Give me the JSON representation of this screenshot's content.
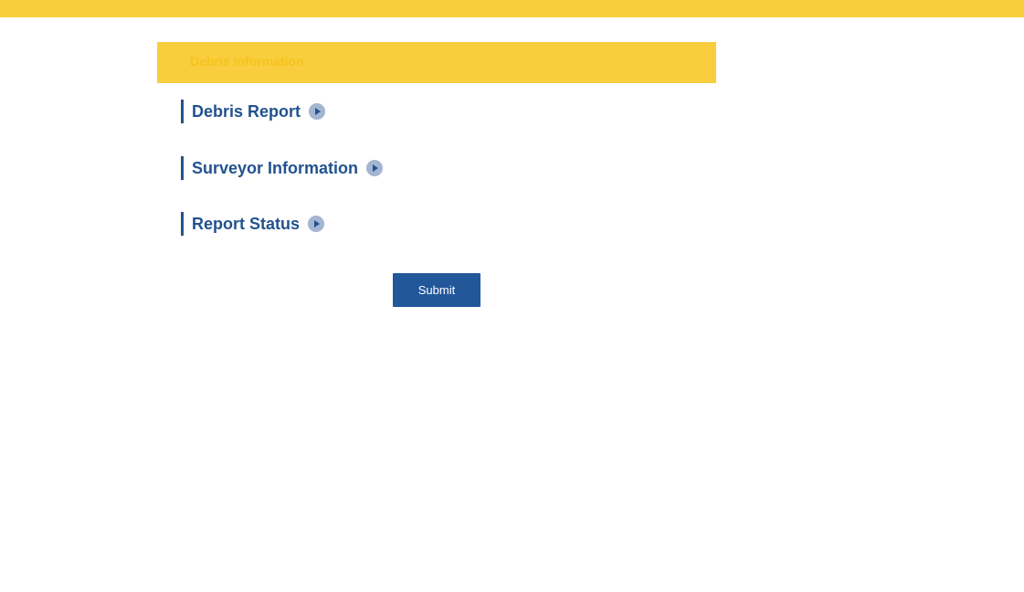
{
  "banner": {
    "text": "Debris Information"
  },
  "sections": [
    {
      "label": "Debris Report",
      "icon": "chevron-right-circle-icon"
    },
    {
      "label": "Surveyor Information",
      "icon": "chevron-right-circle-icon"
    },
    {
      "label": "Report Status",
      "icon": "chevron-right-circle-icon"
    }
  ],
  "submit": {
    "label": "Submit"
  },
  "colors": {
    "accent_yellow": "#f8ce3f",
    "primary_blue": "#22528f",
    "icon_bg": "#a3b5d1",
    "button_blue": "#22579a"
  }
}
